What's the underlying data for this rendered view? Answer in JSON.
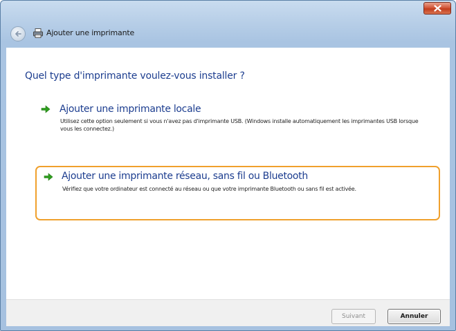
{
  "window": {
    "title": "Ajouter une imprimante",
    "close_icon": "close-icon"
  },
  "navbar": {
    "back_icon": "back-arrow-icon",
    "printer_icon": "printer-icon"
  },
  "content": {
    "heading": "Quel type d'imprimante voulez-vous installer ?",
    "options": [
      {
        "icon": "green-arrow-icon",
        "title": "Ajouter une imprimante locale",
        "description": "Utilisez cette option seulement si vous n'avez pas d'imprimante USB. (Windows installe automatiquement les imprimantes USB lorsque vous les connectez.)"
      },
      {
        "icon": "green-arrow-icon",
        "title": "Ajouter une imprimante réseau, sans fil ou Bluetooth",
        "description": "Vérifiez que votre ordinateur est connecté au réseau ou que votre imprimante Bluetooth ou sans fil est activée.",
        "highlighted": true,
        "highlight_color": "#f0a02c"
      }
    ]
  },
  "footer": {
    "next_label": "Suivant",
    "cancel_label": "Annuler"
  },
  "colors": {
    "heading": "#1c3d8f",
    "frame": "#a9c4e2"
  }
}
